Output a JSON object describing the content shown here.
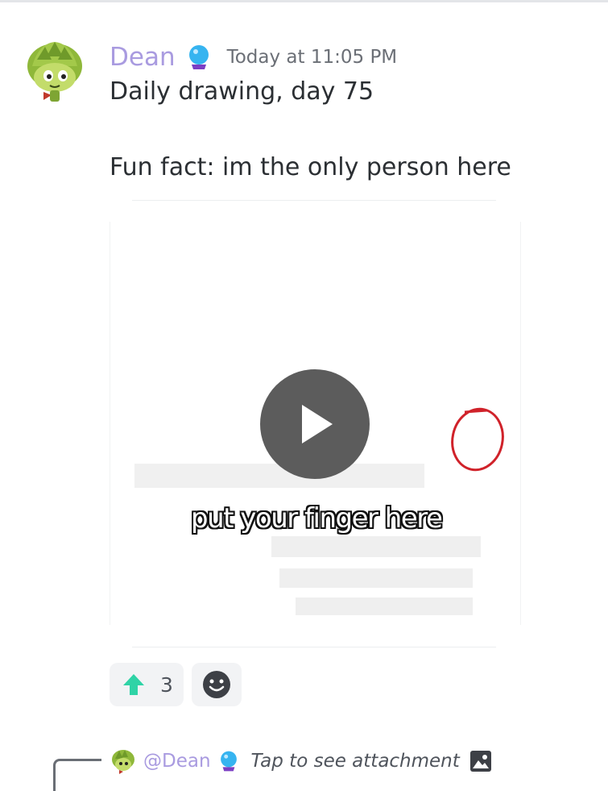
{
  "message": {
    "author": "Dean",
    "timestamp": "Today at 11:05 PM",
    "lines": [
      "Daily drawing, day 75",
      "Fun fact: im the only person here"
    ]
  },
  "video": {
    "caption": "put your finger here",
    "play_icon": "play-icon"
  },
  "reactions": [
    {
      "emoji": "up-arrow-icon",
      "count": "3",
      "color": "#2fd3a6"
    }
  ],
  "reply": {
    "author": "@Dean",
    "text": "Tap to see attachment",
    "icon": "image-icon"
  },
  "colors": {
    "username": "#a99be0",
    "timestamp": "#6b6f76",
    "text": "#2b2f33",
    "chip_bg": "#f2f3f5",
    "play_bg": "#5c5c5c",
    "circle_red": "#d0222a"
  }
}
